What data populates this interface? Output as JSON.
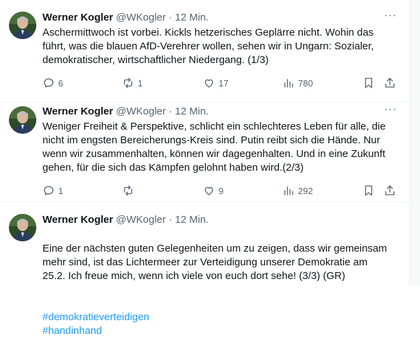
{
  "tweets": [
    {
      "name": "Werner Kogler",
      "handle": "@WKogler",
      "dot": "·",
      "time": "12 Min.",
      "text": "Aschermittwoch ist vorbei. Kickls hetzerisches Geplärre nicht. Wohin das\nführt, was die blauen AfD-Verehrer wollen, sehen wir in Ungarn: Sozialer,\ndemokratischer, wirtschaftlicher Niedergang. (1/3)",
      "replies": "6",
      "retweets": "1",
      "likes": "17",
      "views": "780"
    },
    {
      "name": "Werner Kogler",
      "handle": "@WKogler",
      "dot": "·",
      "time": "12 Min.",
      "text": "Weniger Freiheit & Perspektive, schlicht ein schlechteres Leben für alle, die\nnicht im engsten Bereicherungs-Kreis sind. Putin reibt sich die Hände. Nur\nwenn wir zusammenhalten, können wir dagegenhalten. Und in eine Zukunft\ngehen, für die sich das Kämpfen gelohnt haben wird.(2/3)",
      "replies": "1",
      "retweets": "",
      "likes": "9",
      "views": "292"
    },
    {
      "name": "Werner Kogler",
      "handle": "@WKogler",
      "dot": "·",
      "time": "12 Min.",
      "text": "Eine der nächsten guten Gelegenheiten um zu zeigen, dass wir gemeinsam\nmehr sind, ist das Lichtermeer zur Verteidigung unserer Demokratie am\n25.2. Ich freue mich, wenn ich viele von euch dort sehe! (3/3) (GR)",
      "hashtags": [
        "#demokratieverteidigen",
        "#handinhand"
      ]
    }
  ],
  "icons": {
    "more": "more-horizontal-icon",
    "reply": "reply-icon",
    "retweet": "retweet-icon",
    "like": "heart-icon",
    "views": "views-chart-icon",
    "bookmark": "bookmark-icon",
    "share": "share-icon"
  },
  "colors": {
    "text": "#0f1419",
    "secondary": "#536471",
    "link": "#1d9bf0",
    "divider": "#eff3f4"
  }
}
